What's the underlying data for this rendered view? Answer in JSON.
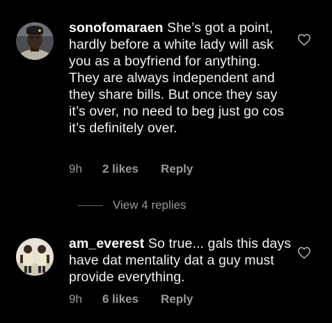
{
  "colors": {
    "background": "#000000",
    "text": "#f2f2f2",
    "secondary": "#9a9a9a"
  },
  "comments": [
    {
      "username": "sonofomaraen",
      "text": "She’s got a point, hardly before a white lady will ask you as a boyfriend for anything. They are always independent and they share bills. But once they say it’s over, no need to beg just go cos it’s definitely over.",
      "time": "9h",
      "likes": "2 likes",
      "reply_label": "Reply",
      "like_icon": "heart-outline-icon"
    },
    {
      "username": "am_everest",
      "text": "So true... gals this days have dat mentality dat a guy must provide everything.",
      "time": "9h",
      "likes": "6 likes",
      "reply_label": "Reply",
      "like_icon": "heart-outline-icon"
    }
  ],
  "view_replies_label": "View 4 replies"
}
